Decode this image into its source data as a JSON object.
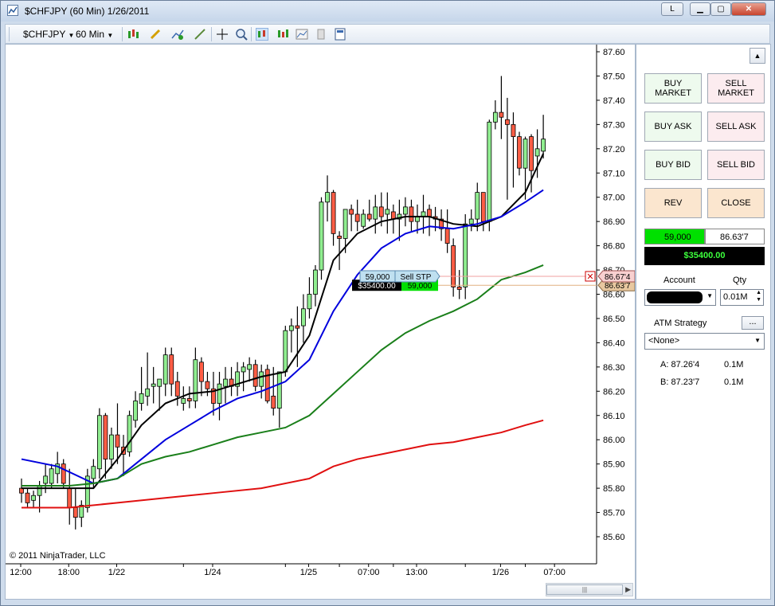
{
  "window": {
    "title": "$CHFJPY (60 Min)  1/26/2011",
    "link_button": "L",
    "minimize_glyph": "▁",
    "maximize_glyph": "▢",
    "close_glyph": "✕"
  },
  "toolbar": {
    "instrument": "$CHFJPY",
    "interval": "60 Min",
    "icons": [
      "bar-type-icon",
      "pencil-draw-icon",
      "indicator-add-icon",
      "crosshair-icon",
      "zoom-icon",
      "chart-trader-icon",
      "chart-style-icon",
      "data-box-icon",
      "properties-icon"
    ]
  },
  "chart": {
    "copyright": "© 2011 NinjaTrader, LLC",
    "y_ticks": [
      "87.60",
      "87.50",
      "87.40",
      "87.30",
      "87.20",
      "87.10",
      "87.00",
      "86.90",
      "86.80",
      "86.70",
      "86.60",
      "86.50",
      "86.40",
      "86.30",
      "86.20",
      "86.10",
      "86.00",
      "85.90",
      "85.80",
      "85.70",
      "85.60"
    ],
    "x_ticks": [
      "12:00",
      "18:00",
      "1/22",
      "1/24",
      "1/25",
      "07:00",
      "13:00",
      "1/26",
      "07:00"
    ],
    "position_marker": {
      "pnl": "$35400.00",
      "qty": "59,000",
      "price_tag": "86.63'7"
    },
    "stop_marker": {
      "qty": "59,000",
      "label": "Sell STP",
      "price_tag": "86.67'4",
      "cancel_glyph": "✕"
    }
  },
  "chart_data": {
    "type": "candlestick",
    "instrument": "$CHFJPY",
    "interval": "60 Min",
    "y_range": [
      85.56,
      87.62
    ],
    "candles": [
      [
        85.8,
        85.84,
        85.74,
        85.78
      ],
      [
        85.78,
        85.8,
        85.72,
        85.74
      ],
      [
        85.75,
        85.79,
        85.72,
        85.77
      ],
      [
        85.77,
        85.83,
        85.7,
        85.81
      ],
      [
        85.82,
        85.9,
        85.78,
        85.85
      ],
      [
        85.82,
        85.9,
        85.8,
        85.88
      ],
      [
        85.86,
        85.95,
        85.82,
        85.9
      ],
      [
        85.9,
        85.92,
        85.8,
        85.82
      ],
      [
        85.8,
        85.88,
        85.65,
        85.72
      ],
      [
        85.72,
        85.8,
        85.63,
        85.68
      ],
      [
        85.68,
        85.75,
        85.64,
        85.73
      ],
      [
        85.72,
        85.88,
        85.7,
        85.85
      ],
      [
        85.84,
        85.92,
        85.8,
        85.89
      ],
      [
        85.88,
        86.13,
        85.84,
        86.1
      ],
      [
        86.1,
        86.11,
        85.84,
        85.92
      ],
      [
        85.92,
        86.05,
        85.88,
        86.02
      ],
      [
        86.02,
        86.15,
        85.9,
        85.97
      ],
      [
        85.97,
        86.02,
        85.85,
        85.94
      ],
      [
        85.95,
        86.12,
        85.93,
        86.1
      ],
      [
        86.08,
        86.2,
        86.05,
        86.16
      ],
      [
        86.15,
        86.3,
        86.12,
        86.19
      ],
      [
        86.18,
        86.36,
        86.14,
        86.21
      ],
      [
        86.22,
        86.3,
        86.15,
        86.23
      ],
      [
        86.22,
        86.25,
        86.12,
        86.25
      ],
      [
        86.23,
        86.38,
        86.18,
        86.35
      ],
      [
        86.35,
        86.38,
        86.18,
        86.23
      ],
      [
        86.24,
        86.28,
        86.14,
        86.18
      ],
      [
        86.15,
        86.22,
        86.12,
        86.17
      ],
      [
        86.17,
        86.22,
        86.13,
        86.16
      ],
      [
        86.16,
        86.38,
        86.13,
        86.33
      ],
      [
        86.32,
        86.34,
        86.18,
        86.24
      ],
      [
        86.24,
        86.28,
        86.18,
        86.21
      ],
      [
        86.21,
        86.28,
        86.1,
        86.15
      ],
      [
        86.15,
        86.28,
        86.08,
        86.23
      ],
      [
        86.22,
        86.3,
        86.15,
        86.25
      ],
      [
        86.25,
        86.3,
        86.18,
        86.22
      ],
      [
        86.22,
        86.32,
        86.18,
        86.28
      ],
      [
        86.28,
        86.32,
        86.2,
        86.3
      ],
      [
        86.29,
        86.34,
        86.24,
        86.31
      ],
      [
        86.31,
        86.33,
        86.2,
        86.22
      ],
      [
        86.22,
        86.31,
        86.17,
        86.28
      ],
      [
        86.29,
        86.31,
        86.15,
        86.16
      ],
      [
        86.18,
        86.3,
        86.1,
        86.13
      ],
      [
        86.13,
        86.25,
        86.05,
        86.28
      ],
      [
        86.28,
        86.47,
        86.26,
        86.45
      ],
      [
        86.45,
        86.5,
        86.36,
        86.47
      ],
      [
        86.47,
        86.55,
        86.3,
        86.46
      ],
      [
        86.47,
        86.6,
        86.4,
        86.54
      ],
      [
        86.54,
        86.67,
        86.5,
        86.6
      ],
      [
        86.6,
        86.72,
        86.55,
        86.7
      ],
      [
        86.7,
        87.0,
        86.66,
        86.98
      ],
      [
        86.98,
        87.09,
        86.9,
        87.02
      ],
      [
        87.02,
        87.03,
        86.8,
        86.85
      ],
      [
        86.84,
        86.86,
        86.7,
        86.83
      ],
      [
        86.83,
        86.9,
        86.77,
        86.95
      ],
      [
        86.95,
        86.97,
        86.86,
        86.93
      ],
      [
        86.93,
        86.99,
        86.86,
        86.9
      ],
      [
        86.88,
        86.95,
        86.87,
        86.93
      ],
      [
        86.93,
        86.99,
        86.9,
        86.91
      ],
      [
        86.91,
        87.01,
        86.85,
        86.96
      ],
      [
        86.96,
        87.02,
        86.88,
        86.92
      ],
      [
        86.93,
        87.02,
        86.85,
        86.95
      ],
      [
        86.94,
        86.97,
        86.85,
        86.91
      ],
      [
        86.91,
        86.99,
        86.82,
        86.93
      ],
      [
        86.93,
        87.0,
        86.88,
        86.96
      ],
      [
        86.96,
        86.99,
        86.86,
        86.9
      ],
      [
        86.9,
        86.97,
        86.85,
        86.92
      ],
      [
        86.92,
        87.01,
        86.85,
        86.94
      ],
      [
        86.95,
        86.97,
        86.84,
        86.92
      ],
      [
        86.92,
        86.96,
        86.86,
        86.91
      ],
      [
        86.91,
        86.95,
        86.82,
        86.87
      ],
      [
        86.87,
        86.95,
        86.77,
        86.81
      ],
      [
        86.8,
        86.83,
        86.59,
        86.63
      ],
      [
        86.63,
        86.7,
        86.58,
        86.62
      ],
      [
        86.63,
        86.93,
        86.58,
        86.89
      ],
      [
        86.89,
        86.95,
        86.86,
        86.91
      ],
      [
        86.91,
        87.06,
        86.86,
        87.02
      ],
      [
        87.02,
        87.02,
        86.86,
        86.9
      ],
      [
        86.9,
        87.32,
        86.86,
        87.31
      ],
      [
        87.31,
        87.4,
        87.28,
        87.35
      ],
      [
        87.35,
        87.5,
        87.24,
        87.33
      ],
      [
        87.32,
        87.41,
        86.99,
        87.3
      ],
      [
        87.3,
        87.35,
        87.04,
        87.25
      ],
      [
        87.25,
        87.27,
        87.09,
        87.12
      ],
      [
        87.12,
        87.25,
        86.99,
        87.24
      ],
      [
        87.25,
        87.26,
        87.02,
        87.11
      ],
      [
        87.17,
        87.28,
        87.08,
        87.2
      ],
      [
        87.19,
        87.34,
        87.16,
        87.24
      ]
    ],
    "series": [
      {
        "name": "fast-ma",
        "color": "#000000",
        "y_start": 85.8,
        "points": [
          [
            0,
            85.8
          ],
          [
            8,
            85.8
          ],
          [
            12,
            85.8
          ],
          [
            16,
            85.92
          ],
          [
            20,
            86.06
          ],
          [
            24,
            86.15
          ],
          [
            28,
            86.19
          ],
          [
            32,
            86.2
          ],
          [
            36,
            86.23
          ],
          [
            40,
            86.26
          ],
          [
            44,
            86.28
          ],
          [
            48,
            86.43
          ],
          [
            52,
            86.74
          ],
          [
            56,
            86.85
          ],
          [
            60,
            86.9
          ],
          [
            64,
            86.92
          ],
          [
            68,
            86.92
          ],
          [
            72,
            86.89
          ],
          [
            76,
            86.88
          ],
          [
            80,
            86.92
          ],
          [
            84,
            87.02
          ],
          [
            87,
            87.18
          ]
        ]
      },
      {
        "name": "mid-ma",
        "color": "#0000dd",
        "points": [
          [
            0,
            85.92
          ],
          [
            6,
            85.89
          ],
          [
            12,
            85.82
          ],
          [
            16,
            85.84
          ],
          [
            20,
            85.92
          ],
          [
            24,
            86.0
          ],
          [
            28,
            86.06
          ],
          [
            32,
            86.12
          ],
          [
            36,
            86.17
          ],
          [
            40,
            86.2
          ],
          [
            44,
            86.24
          ],
          [
            48,
            86.33
          ],
          [
            52,
            86.53
          ],
          [
            56,
            86.68
          ],
          [
            60,
            86.79
          ],
          [
            64,
            86.85
          ],
          [
            68,
            86.88
          ],
          [
            72,
            86.87
          ],
          [
            76,
            86.89
          ],
          [
            80,
            86.92
          ],
          [
            84,
            86.98
          ],
          [
            87,
            87.03
          ]
        ]
      },
      {
        "name": "slow-ma",
        "color": "#1a7f1a",
        "points": [
          [
            0,
            85.81
          ],
          [
            8,
            85.81
          ],
          [
            12,
            85.82
          ],
          [
            16,
            85.84
          ],
          [
            20,
            85.9
          ],
          [
            24,
            85.93
          ],
          [
            28,
            85.95
          ],
          [
            32,
            85.98
          ],
          [
            36,
            86.01
          ],
          [
            40,
            86.03
          ],
          [
            44,
            86.05
          ],
          [
            48,
            86.1
          ],
          [
            52,
            86.19
          ],
          [
            56,
            86.28
          ],
          [
            60,
            86.37
          ],
          [
            64,
            86.44
          ],
          [
            68,
            86.49
          ],
          [
            72,
            86.53
          ],
          [
            76,
            86.58
          ],
          [
            80,
            86.66
          ],
          [
            84,
            86.69
          ],
          [
            87,
            86.72
          ]
        ]
      },
      {
        "name": "long-ma",
        "color": "#e01010",
        "points": [
          [
            0,
            85.72
          ],
          [
            8,
            85.72
          ],
          [
            16,
            85.74
          ],
          [
            24,
            85.76
          ],
          [
            32,
            85.78
          ],
          [
            40,
            85.8
          ],
          [
            48,
            85.84
          ],
          [
            52,
            85.89
          ],
          [
            56,
            85.92
          ],
          [
            60,
            85.94
          ],
          [
            64,
            85.96
          ],
          [
            68,
            85.98
          ],
          [
            72,
            85.99
          ],
          [
            76,
            86.01
          ],
          [
            80,
            86.03
          ],
          [
            84,
            86.06
          ],
          [
            87,
            86.08
          ]
        ]
      }
    ],
    "position_line": 86.637,
    "stop_line": 86.674
  },
  "panel": {
    "buttons": [
      {
        "label": "BUY\nMARKET",
        "side": "buy"
      },
      {
        "label": "SELL\nMARKET",
        "side": "sell"
      },
      {
        "label": "BUY ASK",
        "side": "buy"
      },
      {
        "label": "SELL ASK",
        "side": "sell"
      },
      {
        "label": "BUY BID",
        "side": "buy"
      },
      {
        "label": "SELL BID",
        "side": "sell"
      },
      {
        "label": "REV",
        "side": "rev"
      },
      {
        "label": "CLOSE",
        "side": "rev"
      }
    ],
    "position_qty": "59,000",
    "position_price": "86.63'7",
    "position_pnl": "$35400.00",
    "account_label": "Account",
    "qty_label": "Qty",
    "qty_value": "0.01M",
    "atm_label": "ATM Strategy",
    "atm_button": "...",
    "atm_value": "<None>",
    "ask_label": "A: 87.26'4",
    "ask_size": "0.1M",
    "bid_label": "B: 87.23'7",
    "bid_size": "0.1M",
    "colors": {
      "buy": "#eefaee",
      "sell": "#fcecef",
      "rev": "#fbe6cf",
      "position_green": "#00e000"
    }
  }
}
